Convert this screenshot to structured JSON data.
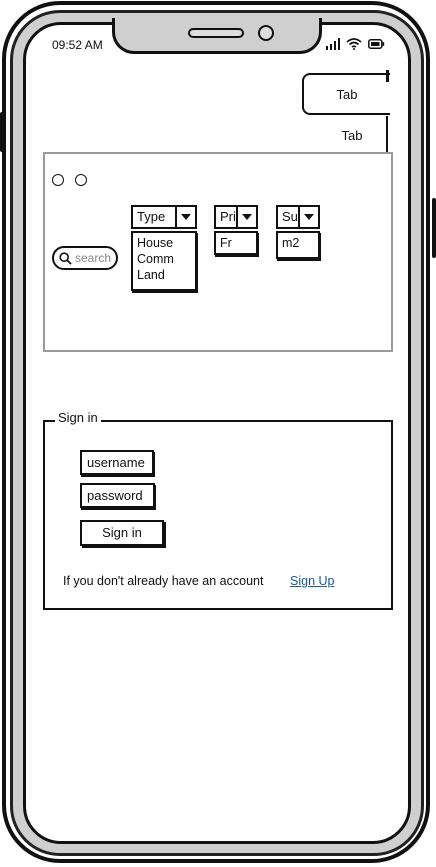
{
  "status_bar": {
    "time": "09:52 AM",
    "icons": [
      "signal-icon",
      "wifi-icon",
      "battery-icon"
    ]
  },
  "tabs": [
    {
      "label": "Tab"
    },
    {
      "label": "Tab"
    }
  ],
  "search": {
    "placeholder": "search",
    "type_dropdown": {
      "label": "Type",
      "options": [
        "House",
        "Comm",
        "Land"
      ]
    },
    "price_dropdown": {
      "label": "Pri",
      "options": [
        "Fr"
      ]
    },
    "surface_dropdown": {
      "label": "Sur",
      "options": [
        "m2"
      ]
    }
  },
  "signin": {
    "legend": "Sign in",
    "username_placeholder": "username",
    "password_placeholder": "password",
    "button_label": "Sign in",
    "account_text": "If you don't already have an account",
    "signup_label": "Sign Up"
  },
  "colors": {
    "ink": "#111111",
    "bezel": "#cfcfcf",
    "panel_border": "#9a9a9a",
    "link": "#1a5a96"
  }
}
